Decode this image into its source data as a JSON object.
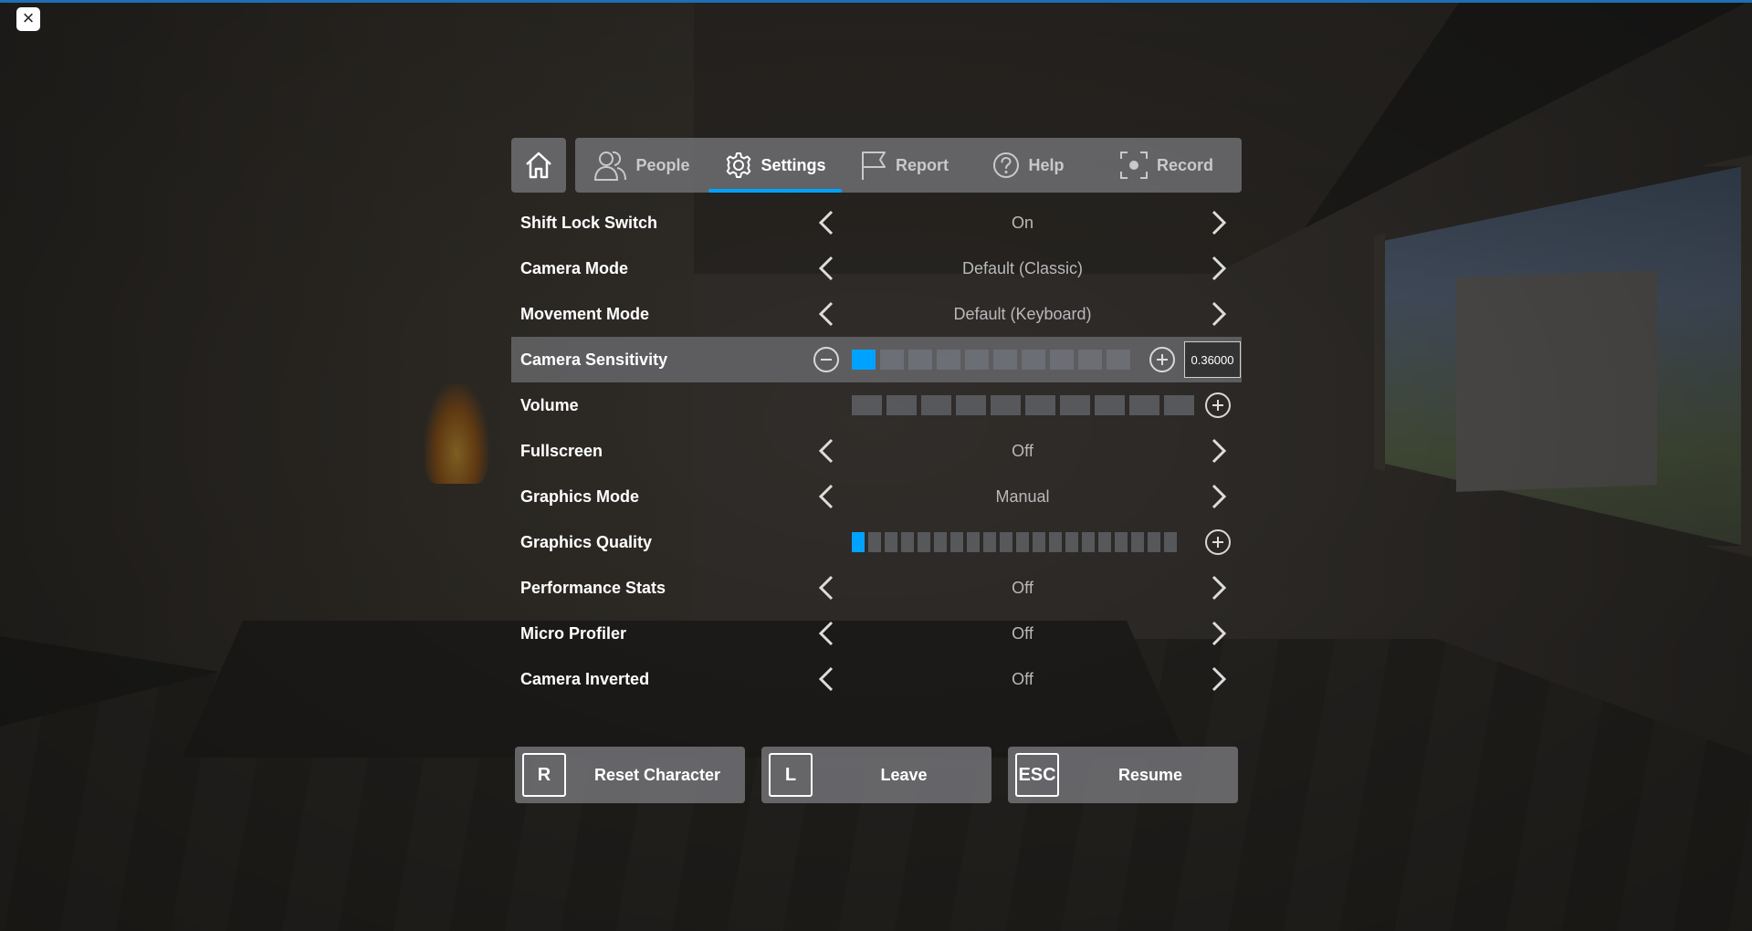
{
  "tabs": {
    "home_icon": "home-icon",
    "items": [
      {
        "label": "People",
        "icon": "people-icon"
      },
      {
        "label": "Settings",
        "icon": "gear-icon"
      },
      {
        "label": "Report",
        "icon": "flag-icon"
      },
      {
        "label": "Help",
        "icon": "question-icon"
      },
      {
        "label": "Record",
        "icon": "record-icon"
      }
    ],
    "active": "Settings"
  },
  "settings": {
    "shift_lock": {
      "label": "Shift Lock Switch",
      "value": "On"
    },
    "camera_mode": {
      "label": "Camera Mode",
      "value": "Default (Classic)"
    },
    "movement_mode": {
      "label": "Movement Mode",
      "value": "Default (Keyboard)"
    },
    "camera_sensitivity": {
      "label": "Camera Sensitivity",
      "value": "0.36000",
      "level_fraction": 0.1,
      "segments": 10
    },
    "volume": {
      "label": "Volume",
      "level_fraction": 0,
      "segments": 10
    },
    "fullscreen": {
      "label": "Fullscreen",
      "value": "Off"
    },
    "graphics_mode": {
      "label": "Graphics Mode",
      "value": "Manual"
    },
    "graphics_quality": {
      "label": "Graphics Quality",
      "level": 1,
      "segments": 20
    },
    "performance_stats": {
      "label": "Performance Stats",
      "value": "Off"
    },
    "micro_profiler": {
      "label": "Micro Profiler",
      "value": "Off"
    },
    "camera_inverted": {
      "label": "Camera Inverted",
      "value": "Off"
    }
  },
  "actions": {
    "reset": {
      "key": "R",
      "label": "Reset Character"
    },
    "leave": {
      "key": "L",
      "label": "Leave"
    },
    "resume": {
      "key": "ESC",
      "label": "Resume"
    }
  },
  "colors": {
    "accent": "#00a2ff",
    "top_bar": "#1e6fb5"
  }
}
